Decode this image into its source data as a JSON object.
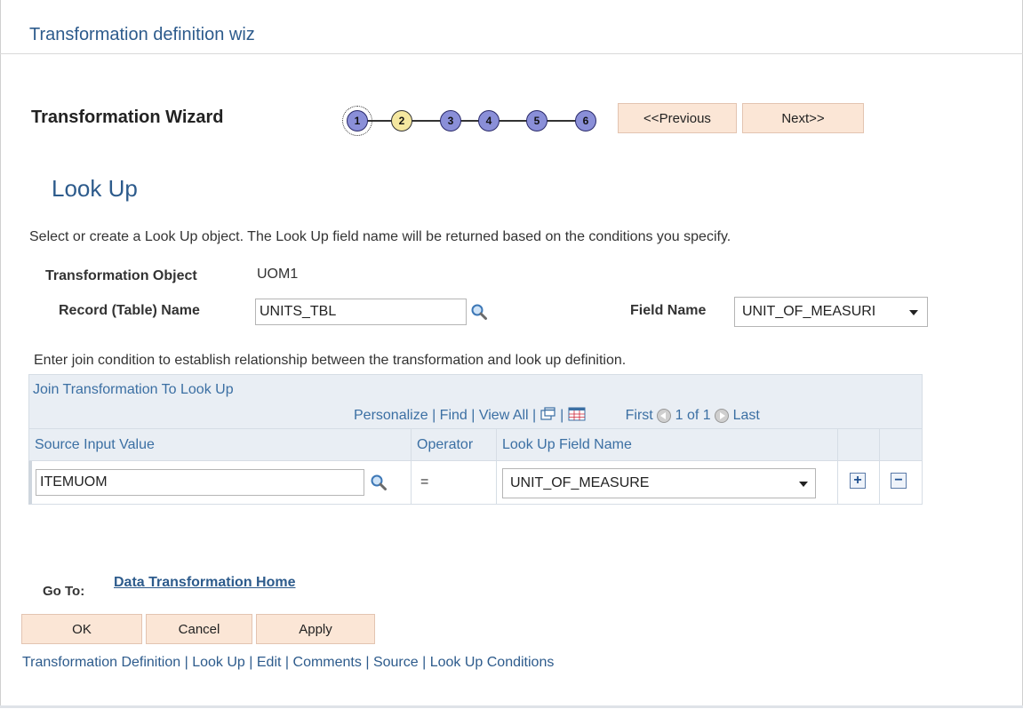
{
  "window": {
    "title": "Transformation definition wiz"
  },
  "wizard": {
    "label": "Transformation Wizard",
    "steps": [
      "1",
      "2",
      "3",
      "4",
      "5",
      "6"
    ],
    "current_step": "2",
    "prev_label": "<<Previous",
    "next_label": "Next>>"
  },
  "page": {
    "title": "Look Up",
    "instructions": "Select or create a Look Up object. The Look Up field name will be returned based on the conditions you specify.",
    "transformation_object_label": "Transformation Object",
    "transformation_object_value": "UOM1",
    "record_name_label": "Record (Table) Name",
    "record_name_value": "UNITS_TBL",
    "field_name_label": "Field Name",
    "field_name_value": "UNIT_OF_MEASURI",
    "join_instructions": "Enter join condition to establish relationship between the transformation and look up definition."
  },
  "grid": {
    "title": "Join Transformation To Look Up",
    "personalize": "Personalize",
    "find": "Find",
    "view_all": "View All",
    "sep": "|",
    "first": "First",
    "pagination": "1 of 1",
    "last": "Last",
    "columns": [
      "Source Input Value",
      "Operator",
      "Look Up Field Name"
    ],
    "rows": [
      {
        "source": "ITEMUOM",
        "operator": "=",
        "lookup_field": "UNIT_OF_MEASURE"
      }
    ]
  },
  "goto": {
    "label": "Go To:",
    "link": "Data Transformation Home"
  },
  "buttons": {
    "ok": "OK",
    "cancel": "Cancel",
    "apply": "Apply"
  },
  "bottom_links": [
    "Transformation Definition",
    "Look Up",
    "Edit",
    "Comments",
    "Source",
    "Look Up Conditions"
  ],
  "colors": {
    "accent": "#2d5b8c",
    "button_bg": "#fbe6d6",
    "step_fill": "#8a8fd8",
    "current_step_fill": "#f4e7a0"
  }
}
